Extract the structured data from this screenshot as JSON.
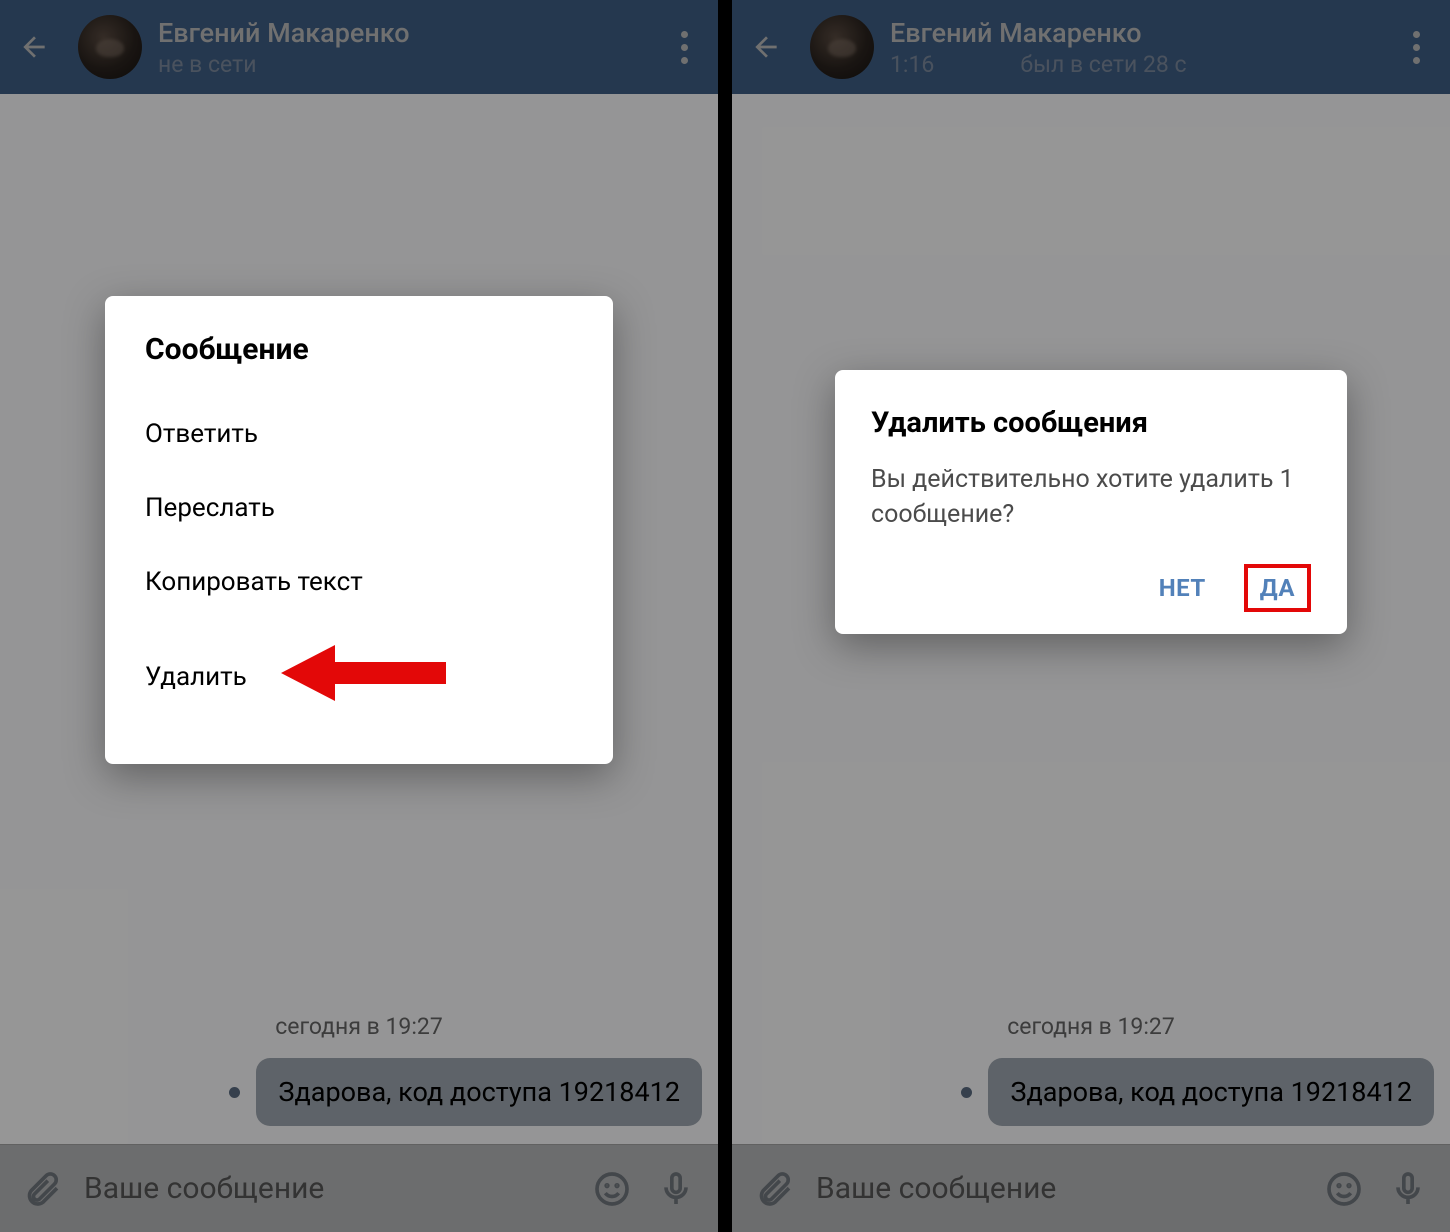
{
  "left": {
    "header": {
      "name": "Евгений Макаренко",
      "status": "не в сети"
    },
    "chat": {
      "timestamp": "сегодня в 19:27",
      "message": "Здарова, код доступа 19218412"
    },
    "input": {
      "placeholder": "Ваше сообщение"
    },
    "dialog": {
      "title": "Сообщение",
      "items": {
        "reply": "Ответить",
        "forward": "Переслать",
        "copy": "Копировать текст",
        "delete": "Удалить"
      }
    }
  },
  "right": {
    "header": {
      "name": "Евгений Макаренко",
      "time_left": "1:16",
      "status": "был в сети 28 с"
    },
    "chat": {
      "timestamp": "сегодня в 19:27",
      "message": "Здарова, код доступа 19218412"
    },
    "input": {
      "placeholder": "Ваше сообщение"
    },
    "dialog": {
      "title": "Удалить сообщения",
      "body": "Вы действительно хотите удалить 1 сообщение?",
      "no": "НЕТ",
      "yes": "ДА"
    }
  }
}
